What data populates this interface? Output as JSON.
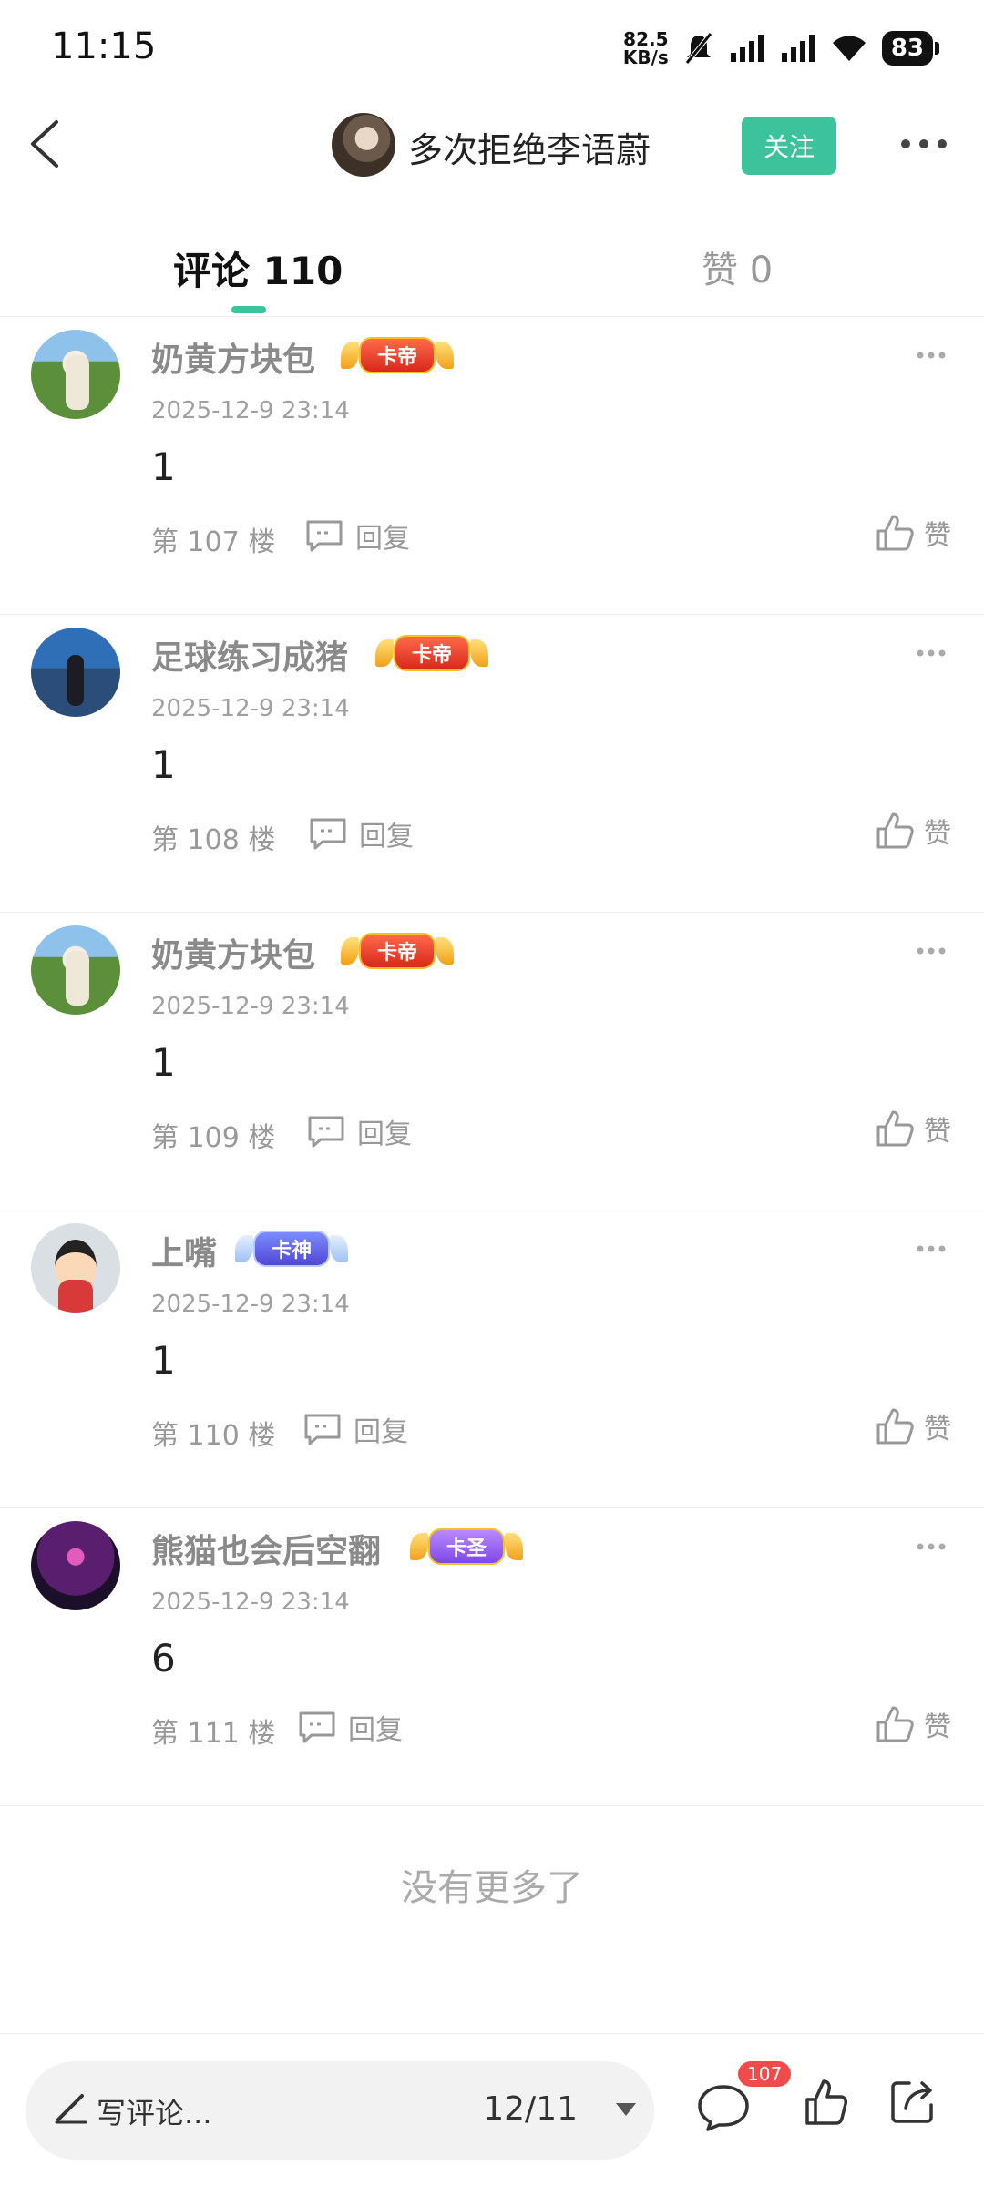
{
  "status_bar": {
    "time": "11:15",
    "net_speed_value": "82.5",
    "net_speed_unit": "KB/s",
    "battery": "83",
    "icons": [
      "mute-bell-icon",
      "signal-icon",
      "signal-icon",
      "wifi-icon",
      "battery-icon"
    ]
  },
  "header": {
    "username": "多次拒绝李语蔚",
    "follow_label": "关注"
  },
  "tabs": {
    "comments_label": "评论 110",
    "likes_label": "赞 0",
    "active_color": "#3cc39c"
  },
  "comments": [
    {
      "username": "奶黄方块包",
      "badge": "卡帝",
      "time": "2025-12-9 23:14",
      "text": "1",
      "floor": "第 107 楼",
      "reply": "回复",
      "like": "赞"
    },
    {
      "username": "足球练习成猪",
      "badge": "卡帝",
      "time": "2025-12-9 23:14",
      "text": "1",
      "floor": "第 108 楼",
      "reply": "回复",
      "like": "赞"
    },
    {
      "username": "奶黄方块包",
      "badge": "卡帝",
      "time": "2025-12-9 23:14",
      "text": "1",
      "floor": "第 109 楼",
      "reply": "回复",
      "like": "赞"
    },
    {
      "username": "上嘴",
      "badge": "卡神",
      "time": "2025-12-9 23:14",
      "text": "1",
      "floor": "第 110 楼",
      "reply": "回复",
      "like": "赞"
    },
    {
      "username": "熊猫也会后空翻",
      "badge": "卡圣",
      "time": "2025-12-9 23:14",
      "text": "6",
      "floor": "第 111 楼",
      "reply": "回复",
      "like": "赞"
    }
  ],
  "footer_text": "没有更多了",
  "bottom_bar": {
    "write_placeholder": "写评论...",
    "page_indicator": "12/11",
    "comment_count": "107"
  }
}
